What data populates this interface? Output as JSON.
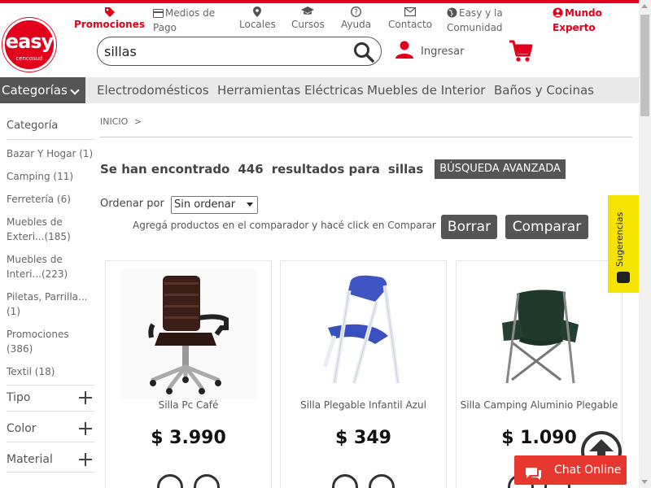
{
  "brand": {
    "logo_text": "easy",
    "logo_sub": "cencosud",
    "primary_color": "#e3001b"
  },
  "topnav": {
    "promociones": "Promociones",
    "medios_pago_1": "Medios de",
    "medios_pago_2": "Pago",
    "locales": "Locales",
    "cursos": "Cursos",
    "ayuda": "Ayuda",
    "contacto": "Contacto",
    "comunidad_1": "Easy y la",
    "comunidad_2": "Comunidad",
    "mundo_1": "Mundo",
    "mundo_2": "Experto"
  },
  "search": {
    "value": "sillas",
    "icon": "search-icon"
  },
  "user": {
    "login_label": "Ingresar"
  },
  "category_bar": {
    "button_label": "Categorías",
    "links": [
      "Electrodomésticos",
      "Herramientas Eléctricas",
      "Muebles de Interior",
      "Baños y Cocinas"
    ]
  },
  "sidebar": {
    "title": "Categoría",
    "items": [
      {
        "line1": "Bazar Y Hogar (1)",
        "line2": ""
      },
      {
        "line1": "Camping (11)",
        "line2": ""
      },
      {
        "line1": "Ferretería (6)",
        "line2": ""
      },
      {
        "line1": "Muebles de",
        "line2": "Exteri...(185)"
      },
      {
        "line1": "Muebles de",
        "line2": "Interi...(223)"
      },
      {
        "line1": "Piletas, Parrilla...",
        "line2": "(1)"
      },
      {
        "line1": "Promociones",
        "line2": "(386)"
      },
      {
        "line1": "Textil (18)",
        "line2": ""
      }
    ],
    "facets": [
      "Tipo",
      "Color",
      "Material"
    ]
  },
  "breadcrumb": {
    "home": "INICIO",
    "sep": ">"
  },
  "results": {
    "prefix": "Se han encontrado",
    "count": "446",
    "middle": "resultados para",
    "term": "sillas",
    "advanced_label": "BÚSQUEDA AVANZADA"
  },
  "sort": {
    "label": "Ordenar por",
    "selected": "Sin ordenar"
  },
  "compare": {
    "hint": "Agregá productos en el comparador y hacé click en Comparar",
    "clear_label": "Borrar",
    "compare_label": "Comparar"
  },
  "products": [
    {
      "name": "Silla Pc Café",
      "price": "$ 3.990"
    },
    {
      "name": "Silla Plegable Infantil Azul",
      "price": "$ 349"
    },
    {
      "name": "Silla Camping Aluminio Plegable",
      "price": "$ 1.090"
    }
  ],
  "feedback_tab": {
    "label": "Sugerencias",
    "color": "#f5e400"
  },
  "chat": {
    "label": "Chat Online",
    "color": "#e8372f"
  }
}
